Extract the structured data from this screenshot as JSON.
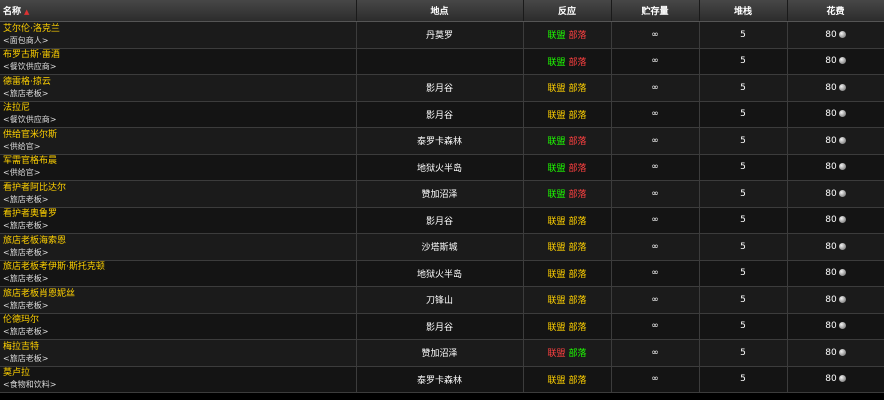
{
  "headers": {
    "name": "名称",
    "location": "地点",
    "react": "反应",
    "stock": "贮存量",
    "stack": "堆栈",
    "cost": "花费"
  },
  "react_labels": {
    "alliance": "联盟",
    "horde": "部落"
  },
  "rows": [
    {
      "name": "艾尔伦·洛克兰",
      "title": "<面包商人>",
      "location": "丹莫罗",
      "a": "green",
      "h": "red",
      "stock": "∞",
      "stack": "5",
      "cost": "80"
    },
    {
      "name": "布罗古斯·雷酒",
      "title": "<餐饮供应商>",
      "location": "",
      "a": "green",
      "h": "red",
      "stock": "∞",
      "stack": "5",
      "cost": "80"
    },
    {
      "name": "德雷格·掠云",
      "title": "<旅店老板>",
      "location": "影月谷",
      "a": "yellow",
      "h": "yellow",
      "stock": "∞",
      "stack": "5",
      "cost": "80"
    },
    {
      "name": "法拉尼",
      "title": "<餐饮供应商>",
      "location": "影月谷",
      "a": "yellow",
      "h": "yellow",
      "stock": "∞",
      "stack": "5",
      "cost": "80"
    },
    {
      "name": "供给官米尔斯",
      "title": "<供给官>",
      "location": "泰罗卡森林",
      "a": "green",
      "h": "red",
      "stock": "∞",
      "stack": "5",
      "cost": "80"
    },
    {
      "name": "军需官格布晨",
      "title": "<供给官>",
      "location": "地狱火半岛",
      "a": "green",
      "h": "red",
      "stock": "∞",
      "stack": "5",
      "cost": "80"
    },
    {
      "name": "看护者阿比达尔",
      "title": "<旅店老板>",
      "location": "赞加沼泽",
      "a": "green",
      "h": "red",
      "stock": "∞",
      "stack": "5",
      "cost": "80"
    },
    {
      "name": "看护者奥鲁罗",
      "title": "<旅店老板>",
      "location": "影月谷",
      "a": "yellow",
      "h": "yellow",
      "stock": "∞",
      "stack": "5",
      "cost": "80"
    },
    {
      "name": "旅店老板海索恩",
      "title": "<旅店老板>",
      "location": "沙塔斯城",
      "a": "yellow",
      "h": "yellow",
      "stock": "∞",
      "stack": "5",
      "cost": "80"
    },
    {
      "name": "旅店老板考伊斯·斯托克顿",
      "title": "<旅店老板>",
      "location": "地狱火半岛",
      "a": "yellow",
      "h": "yellow",
      "stock": "∞",
      "stack": "5",
      "cost": "80"
    },
    {
      "name": "旅店老板肖恩妮丝",
      "title": "<旅店老板>",
      "location": "刀锋山",
      "a": "yellow",
      "h": "yellow",
      "stock": "∞",
      "stack": "5",
      "cost": "80"
    },
    {
      "name": "伦德玛尔",
      "title": "<旅店老板>",
      "location": "影月谷",
      "a": "yellow",
      "h": "yellow",
      "stock": "∞",
      "stack": "5",
      "cost": "80"
    },
    {
      "name": "梅拉吉特",
      "title": "<旅店老板>",
      "location": "赞加沼泽",
      "a": "red",
      "h": "green",
      "stock": "∞",
      "stack": "5",
      "cost": "80"
    },
    {
      "name": "莫卢拉",
      "title": "<食物和饮料>",
      "location": "泰罗卡森林",
      "a": "yellow",
      "h": "yellow",
      "stock": "∞",
      "stack": "5",
      "cost": "80"
    }
  ]
}
